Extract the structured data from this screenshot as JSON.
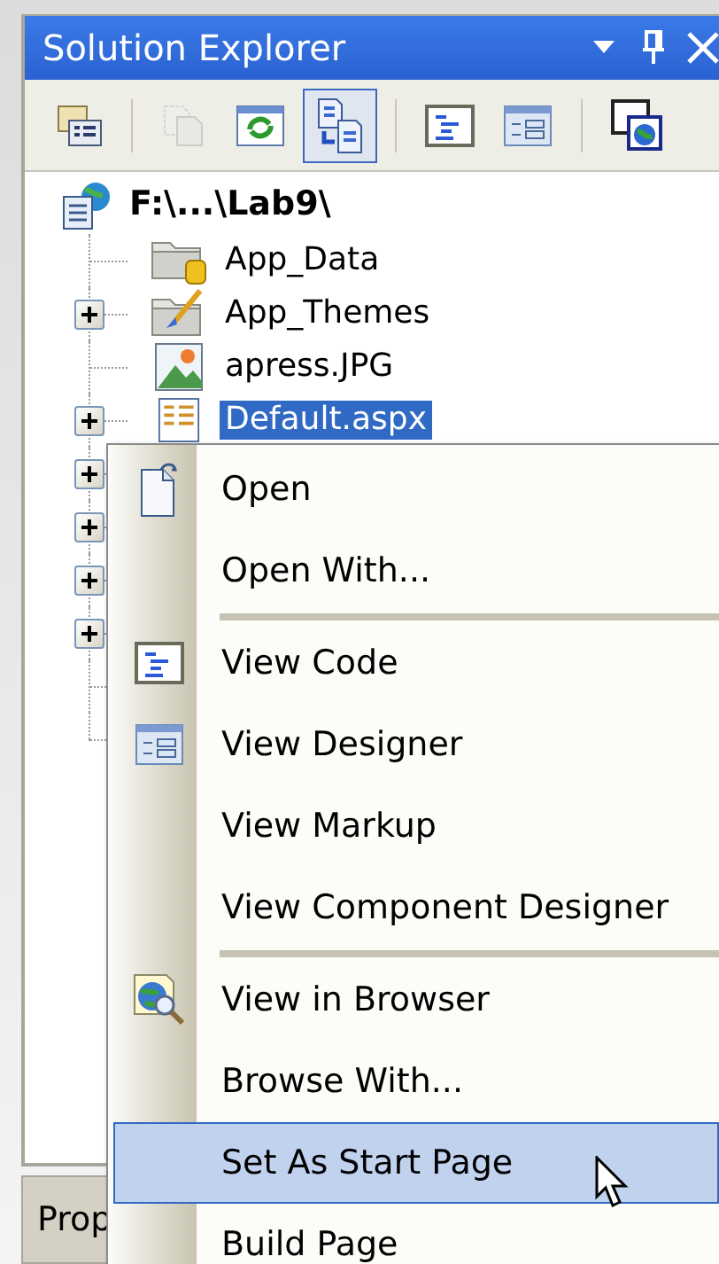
{
  "panel": {
    "title": "Solution Explorer"
  },
  "toolbar": [
    {
      "pressed": false,
      "disabled": false
    },
    {
      "pressed": false,
      "disabled": true
    },
    {
      "pressed": false,
      "disabled": false
    },
    {
      "pressed": true,
      "disabled": false
    },
    {
      "pressed": false,
      "disabled": false
    },
    {
      "pressed": false,
      "disabled": false
    },
    {
      "pressed": false,
      "disabled": false
    }
  ],
  "tree": {
    "root": {
      "label": "F:\\...\\Lab9\\",
      "selected": false
    },
    "children": [
      {
        "label": "App_Data",
        "kind": "data-folder",
        "selected": false
      },
      {
        "label": "App_Themes",
        "kind": "theme-folder",
        "expanded": false,
        "selected": false
      },
      {
        "label": "apress.JPG",
        "kind": "image",
        "selected": false
      },
      {
        "label": "Default.aspx",
        "kind": "page",
        "expanded": false,
        "selected": true
      }
    ],
    "covered_rows": [
      {
        "kind": "expandable",
        "expanded": false
      },
      {
        "kind": "expandable",
        "expanded": false
      },
      {
        "kind": "expandable",
        "expanded": false
      },
      {
        "kind": "expandable",
        "expanded": false
      },
      {
        "kind": "leaf"
      },
      {
        "kind": "leaf"
      }
    ]
  },
  "bottom_tab": {
    "label": "Prop"
  },
  "context_menu": [
    {
      "kind": "item",
      "label": "Open",
      "selected": false
    },
    {
      "kind": "item",
      "label": "Open With...",
      "selected": false
    },
    {
      "kind": "separator"
    },
    {
      "kind": "item",
      "label": "View Code",
      "selected": false
    },
    {
      "kind": "item",
      "label": "View Designer",
      "selected": false
    },
    {
      "kind": "item",
      "label": "View Markup",
      "selected": false
    },
    {
      "kind": "item",
      "label": "View Component Designer",
      "selected": false
    },
    {
      "kind": "separator"
    },
    {
      "kind": "item",
      "label": "View in Browser",
      "selected": false
    },
    {
      "kind": "item",
      "label": "Browse With...",
      "selected": false
    },
    {
      "kind": "item",
      "label": "Set As Start Page",
      "selected": true
    },
    {
      "kind": "item",
      "label": "Build Page",
      "selected": false
    }
  ]
}
